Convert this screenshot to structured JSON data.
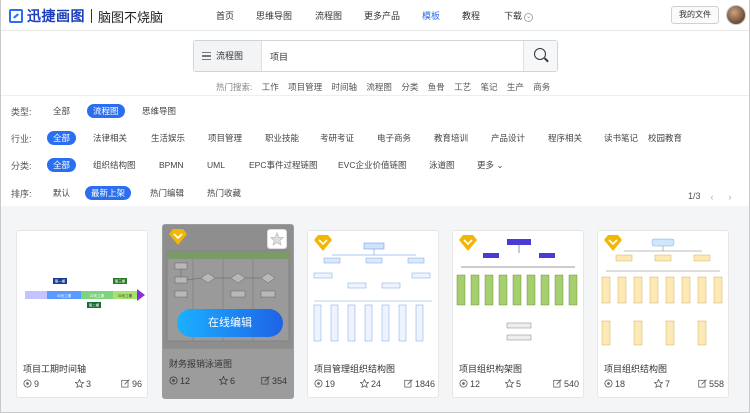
{
  "brand": {
    "name": "迅捷画图",
    "slogan": "脑图不烧脑"
  },
  "nav": [
    {
      "label": "首页",
      "active": false
    },
    {
      "label": "思维导图",
      "active": false
    },
    {
      "label": "流程图",
      "active": false
    },
    {
      "label": "更多产品",
      "active": false
    },
    {
      "label": "模板",
      "active": true
    },
    {
      "label": "教程",
      "active": false
    },
    {
      "label": "下载",
      "active": false
    }
  ],
  "header": {
    "my_files": "我的文件"
  },
  "search": {
    "type": "流程图",
    "query": "项目",
    "hot_label": "热门搜索:",
    "hot": [
      "工作",
      "项目管理",
      "时间轴",
      "流程图",
      "分类",
      "鱼骨",
      "工艺",
      "笔记",
      "生产",
      "商务"
    ]
  },
  "filters": {
    "type": {
      "label": "类型:",
      "options": [
        "全部",
        "流程图",
        "思维导图"
      ],
      "selected": "流程图"
    },
    "industry": {
      "label": "行业:",
      "options": [
        "全部",
        "法律相关",
        "生活娱乐",
        "项目管理",
        "职业技能",
        "考研考证",
        "电子商务",
        "教育培训",
        "产品设计",
        "程序相关",
        "读书笔记",
        "校园教育"
      ],
      "selected": "全部"
    },
    "category": {
      "label": "分类:",
      "options": [
        "全部",
        "组织结构图",
        "BPMN",
        "UML",
        "EPC事件过程链图",
        "EVC企业价值链图",
        "泳道图",
        "更多"
      ],
      "selected": "全部"
    },
    "sort": {
      "label": "排序:",
      "options": [
        "默认",
        "最新上架",
        "热门编辑",
        "热门收藏"
      ],
      "selected": "最新上架"
    }
  },
  "pager": {
    "text": "1/3",
    "prev": "‹",
    "next": "›"
  },
  "hover_button": "在线编辑",
  "cards": [
    {
      "title": "项目工期时间轴",
      "views": "9",
      "stars": "3",
      "edits": "96",
      "icon": "timeline-thumbnail",
      "hover": false,
      "badge": false
    },
    {
      "title": "财务报销泳道图",
      "views": "12",
      "stars": "6",
      "edits": "354",
      "icon": "swimlane-thumbnail",
      "hover": true,
      "badge": true
    },
    {
      "title": "项目管理组织结构图",
      "views": "19",
      "stars": "24",
      "edits": "1846",
      "icon": "org-chart-thumbnail",
      "hover": false,
      "badge": true
    },
    {
      "title": "项目组织构架图",
      "views": "12",
      "stars": "5",
      "edits": "540",
      "icon": "org-chart-thumbnail",
      "hover": false,
      "badge": true
    },
    {
      "title": "项目组织结构图",
      "views": "18",
      "stars": "7",
      "edits": "558",
      "icon": "org-chart-thumbnail",
      "hover": false,
      "badge": true
    }
  ],
  "timeline_labels": [
    "第一期",
    "40天工期",
    "20天工期",
    "第三期",
    "30天工期",
    "第二期"
  ],
  "colors": {
    "accent": "#2b6ff0",
    "badge": "#f2b705",
    "button_start": "#1bb0ff",
    "button_end": "#1e63e6"
  }
}
